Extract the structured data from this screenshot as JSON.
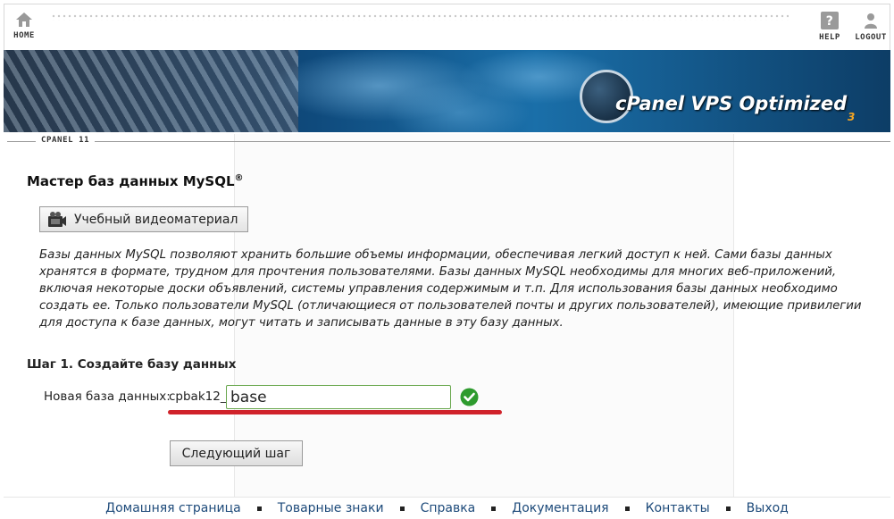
{
  "topbar": {
    "home_label": "HOME",
    "help_label": "HELP",
    "logout_label": "LOGOUT"
  },
  "banner": {
    "brand": "cPanel VPS Optimized",
    "version": "3"
  },
  "section_label": "CPANEL 11",
  "page": {
    "title": "Мастер баз данных MySQL",
    "title_mark": "®",
    "video_button": "Учебный видеоматериал",
    "description": "Базы данных MySQL позволяют хранить большие объемы информации, обеспечивая легкий доступ к ней. Сами базы данных хранятся в формате, трудном для прочтения пользователями. Базы данных MySQL необходимы для многих веб-приложений, включая некоторые доски объявлений, системы управления содержимым и т.п. Для использования базы данных необходимо создать ее. Только пользователи MySQL (отличающиеся от пользователей почты и других пользователей), имеющие привилегии для доступа к базе данных, могут читать и записывать данные в эту базу данных.",
    "step_title": "Шаг 1. Создайте базу данных",
    "field_label": "Новая база данных:",
    "prefix": "cpbak12_",
    "input_value": "base",
    "next_button": "Следующий шаг"
  },
  "footer": {
    "links": [
      "Домашняя страница",
      "Товарные знаки",
      "Справка",
      "Документация",
      "Контакты",
      "Выход"
    ]
  },
  "colors": {
    "accent_red": "#d0222a",
    "valid_green": "#2e9b2e",
    "link_blue": "#1d4a7a"
  }
}
